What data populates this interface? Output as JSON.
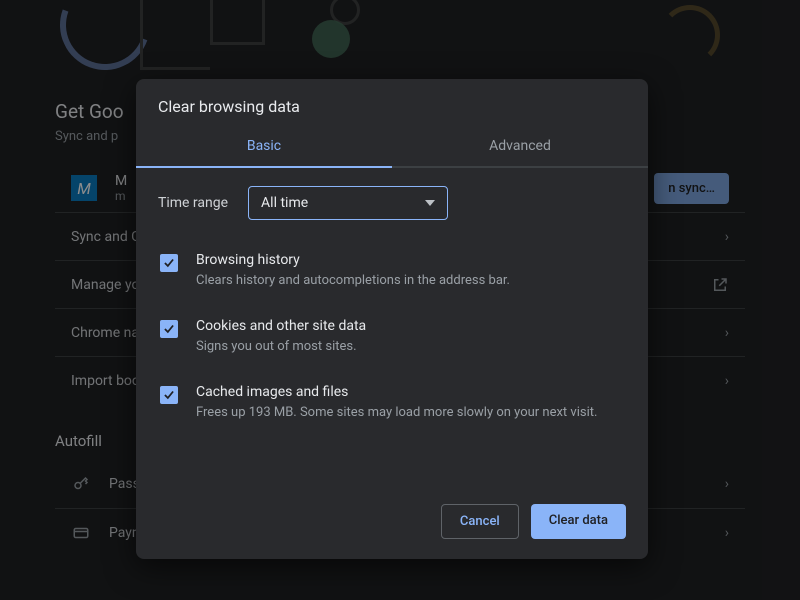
{
  "page": {
    "title": "Get Google smarts in Chrome",
    "title_visible": "Get Goo",
    "subtitle": "Sync and personalize Chrome across your devices",
    "subtitle_visible": "Sync and p",
    "account": {
      "name": "M",
      "email": "m",
      "avatar_letter": "M"
    },
    "sync_button": "Turn on sync…",
    "sync_button_visible": "n sync…",
    "rows": [
      {
        "label": "Sync and Google services"
      },
      {
        "label": "Manage your Google Account"
      },
      {
        "label": "Chrome name and picture"
      },
      {
        "label": "Import bookmarks and settings"
      }
    ],
    "rows_visible": [
      "Sync and G",
      "Manage yo",
      "Chrome na",
      "Import boo"
    ],
    "section_autofill": "Autofill",
    "autofill_rows": [
      {
        "label": "Passwords"
      },
      {
        "label": "Payment methods"
      }
    ],
    "autofill_rows_visible": [
      "Pass",
      "Payment methods"
    ]
  },
  "modal": {
    "title": "Clear browsing data",
    "tabs": {
      "basic": "Basic",
      "advanced": "Advanced",
      "active": "basic"
    },
    "time_range_label": "Time range",
    "time_range_value": "All time",
    "options": [
      {
        "key": "history",
        "checked": true,
        "title": "Browsing history",
        "desc": "Clears history and autocompletions in the address bar."
      },
      {
        "key": "cookies",
        "checked": true,
        "title": "Cookies and other site data",
        "desc": "Signs you out of most sites."
      },
      {
        "key": "cache",
        "checked": true,
        "title": "Cached images and files",
        "desc": "Frees up 193 MB. Some sites may load more slowly on your next visit."
      }
    ],
    "cancel": "Cancel",
    "confirm": "Clear data"
  },
  "colors": {
    "accent": "#8ab4f8",
    "modal_bg": "#292a2d",
    "page_bg": "#202124",
    "text_secondary": "#9aa0a6"
  }
}
